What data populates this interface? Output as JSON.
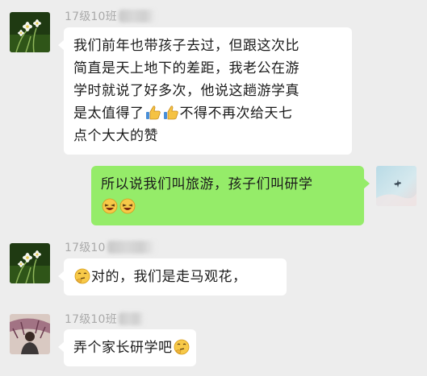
{
  "messages": [
    {
      "sender": "17级10班",
      "lines": [
        "我们前年也带孩子去过，但跟这次比",
        "简直是天上地下的差距，我老公在游",
        "学时就说了好多次，他说这趟游学真",
        "是太值得了",
        "不得不再次给天七",
        "点个大大的赞"
      ],
      "emoji": "thumbs-up-icon"
    },
    {
      "sender": "",
      "lines": [
        "所以说我们叫旅游，孩子们叫研学"
      ],
      "emoji": "laughing-face-icon"
    },
    {
      "sender": "17级10",
      "lines": [
        "对的，我们是走马观花，"
      ],
      "emoji": "thinking-face-icon"
    },
    {
      "sender": "17级10班",
      "lines": [
        "弄个家长研学吧"
      ],
      "emoji": "thinking-face-icon"
    }
  ],
  "colors": {
    "background": "#ededed",
    "bubble_in": "#ffffff",
    "bubble_out": "#95ec69",
    "sender_name": "#a9a9a9"
  }
}
